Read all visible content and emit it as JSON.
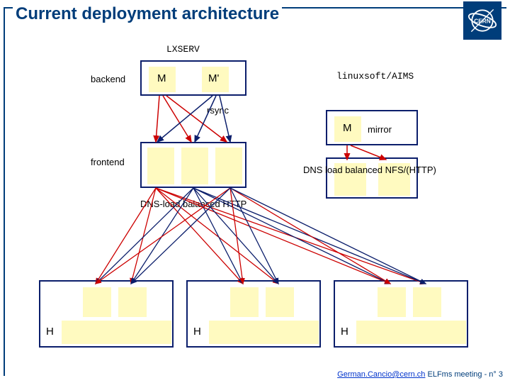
{
  "title": "Current deployment architecture",
  "labels": {
    "lxserv": "LXSERV",
    "backend": "backend",
    "M": "M",
    "Mprime": "M'",
    "rsync": "rsync",
    "linuxsoft": "linuxsoft/AIMS",
    "mirror": "mirror",
    "frontend": "frontend",
    "dns_lb_nfs": "DNS load balanced NFS/(HTTP)",
    "dns_lb_http": "DNS-load balanced HTTP",
    "H": "H"
  },
  "footer": {
    "email": "German.Cancio@cern.ch",
    "rest": " ELFms meeting - n° 3"
  },
  "logo_alt": "CERN"
}
